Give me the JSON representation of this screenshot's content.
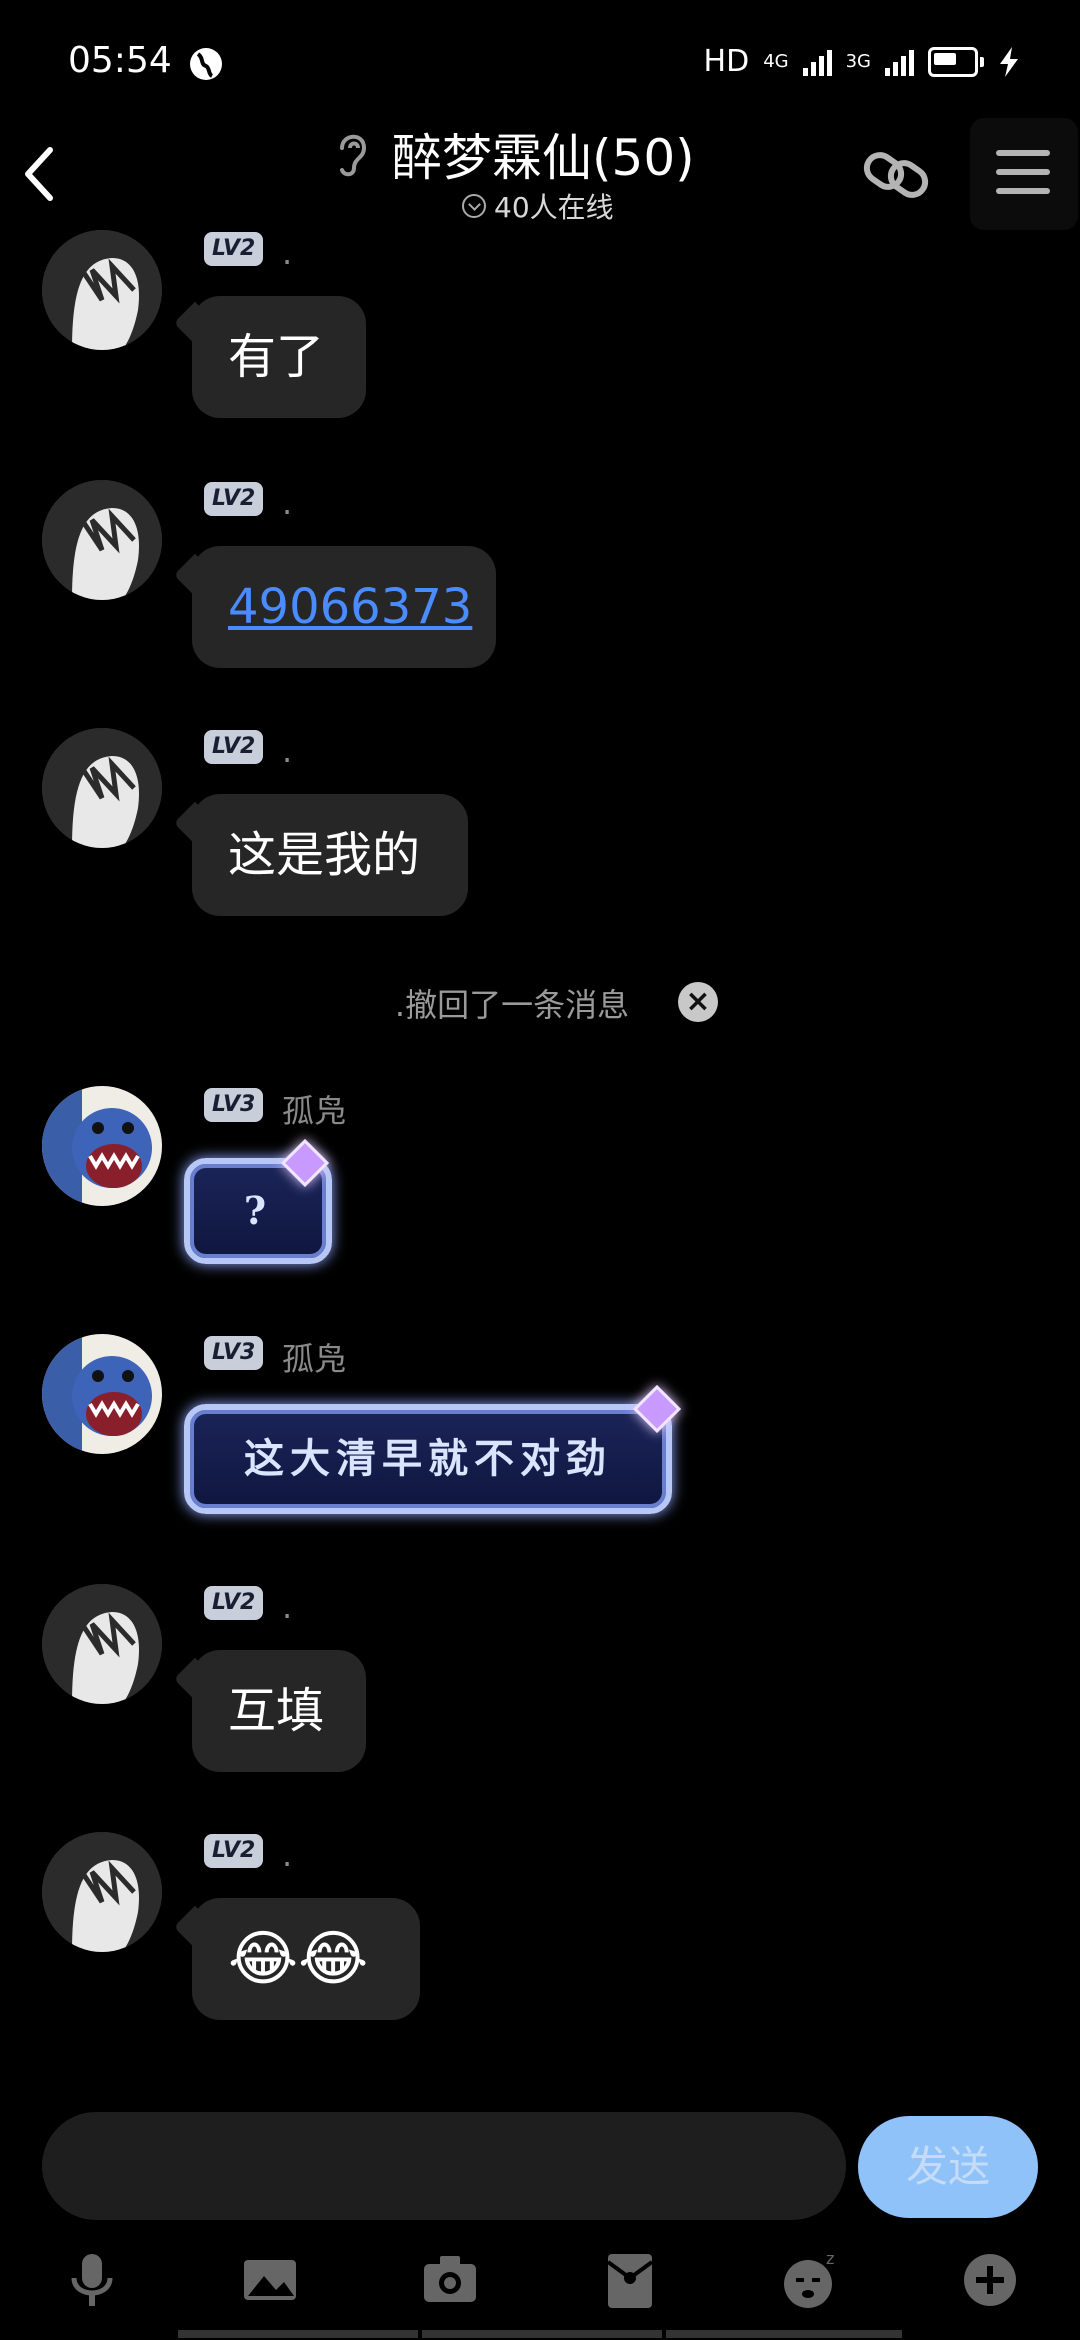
{
  "status_bar": {
    "time": "05:54",
    "network_hd": "HD",
    "network_1": "4G",
    "network_2": "3G"
  },
  "header": {
    "title": "醉梦霖仙(50)",
    "online": "40人在线"
  },
  "messages": [
    {
      "level": "LV2",
      "name": ".",
      "text": "有了"
    },
    {
      "level": "LV2",
      "name": ".",
      "text": "49066373"
    },
    {
      "level": "LV2",
      "name": ".",
      "text": "这是我的"
    },
    {
      "level": "LV3",
      "name": "孤凫",
      "text": "?"
    },
    {
      "level": "LV3",
      "name": "孤凫",
      "text": "这大清早就不对劲"
    },
    {
      "level": "LV2",
      "name": ".",
      "text": "互填"
    },
    {
      "level": "LV2",
      "name": ".",
      "text": "😂😂"
    }
  ],
  "system_notice": ".撤回了一条消息",
  "composer": {
    "send_label": "发送"
  },
  "toolbar": [
    "microphone-icon",
    "image-icon",
    "camera-icon",
    "red-packet-icon",
    "sticker-icon",
    "plus-icon"
  ],
  "colors": {
    "background": "#000000",
    "bubble": "#262626",
    "link": "#4a8cff",
    "send_button": "#8fc2f8",
    "level_badge": "#c9cedb"
  }
}
